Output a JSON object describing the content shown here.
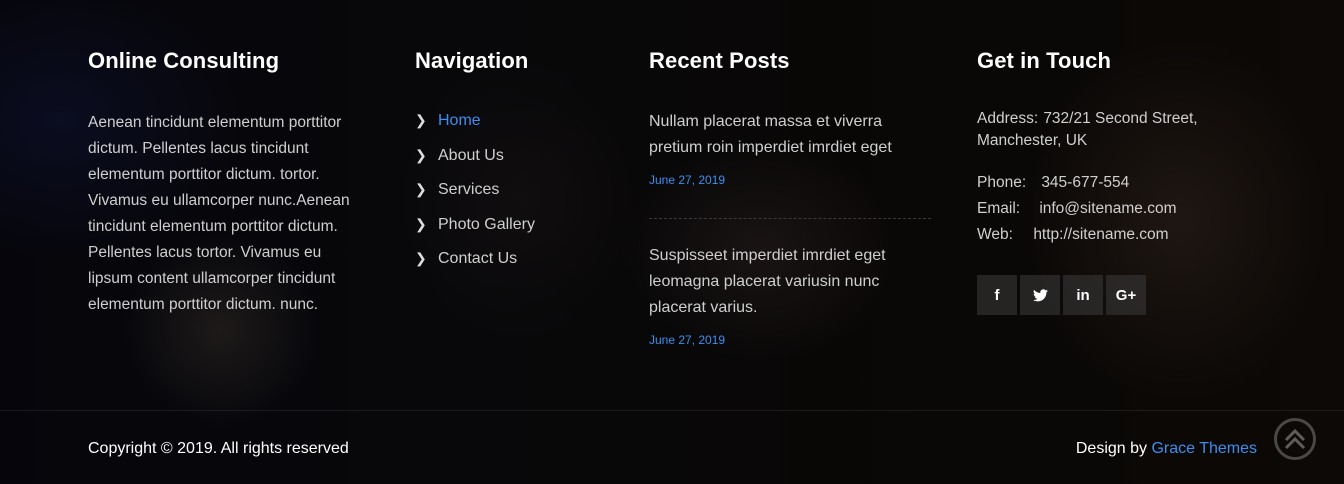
{
  "col1": {
    "title": "Online Consulting",
    "text": "Aenean tincidunt elementum porttitor dictum. Pellentes lacus tincidunt elementum porttitor dictum. tortor. Vivamus eu ullamcorper nunc.Aenean tincidunt elementum porttitor dictum. Pellentes lacus tortor. Vivamus eu lipsum content ullamcorper tincidunt elementum porttitor dictum. nunc."
  },
  "nav": {
    "title": "Navigation",
    "items": [
      {
        "label": "Home"
      },
      {
        "label": "About Us"
      },
      {
        "label": "Services"
      },
      {
        "label": "Photo Gallery"
      },
      {
        "label": "Contact Us"
      }
    ]
  },
  "posts": {
    "title": "Recent Posts",
    "items": [
      {
        "text": "Nullam placerat massa et viverra pretium roin imperdiet imrdiet eget",
        "date": "June 27, 2019"
      },
      {
        "text": "Suspisseet imperdiet imrdiet eget leomagna placerat variusin nunc placerat varius.",
        "date": "June 27, 2019"
      }
    ]
  },
  "contact": {
    "title": "Get in Touch",
    "address_label": "Address:",
    "address_value": "732/21 Second Street, Manchester, UK",
    "phone_label": "Phone:",
    "phone_value": "345-677-554",
    "email_label": "Email:",
    "email_value": "info@sitename.com",
    "web_label": "Web:",
    "web_value": "http://sitename.com",
    "social": [
      {
        "icon": "facebook-icon",
        "glyph": "f"
      },
      {
        "icon": "twitter-icon",
        "glyph": "🐦"
      },
      {
        "icon": "linkedin-icon",
        "glyph": "in"
      },
      {
        "icon": "google-plus-icon",
        "glyph": "G+"
      }
    ]
  },
  "footer": {
    "copyright": "Copyright © 2019. All rights reserved",
    "design_prefix": "Design by",
    "design_link": "Grace Themes"
  }
}
